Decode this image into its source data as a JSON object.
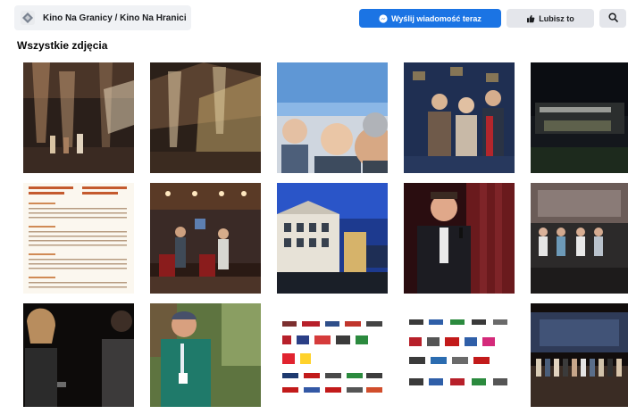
{
  "page": {
    "name": "Kino Na Granicy / Kino Na Hranici"
  },
  "actions": {
    "message_label": "Wyślij wiadomość teraz",
    "like_label": "Lubisz to"
  },
  "section": {
    "title": "Wszystkie zdjęcia"
  },
  "photos": [
    {
      "id": "awards-stage-1",
      "icon": "photo"
    },
    {
      "id": "awards-stage-2",
      "icon": "photo"
    },
    {
      "id": "selfie-three-women",
      "icon": "photo"
    },
    {
      "id": "group-press-wall",
      "icon": "photo"
    },
    {
      "id": "building-night",
      "icon": "photo"
    },
    {
      "id": "schedule-poster",
      "icon": "photo"
    },
    {
      "id": "stage-interview",
      "icon": "photo"
    },
    {
      "id": "town-square-screening",
      "icon": "photo"
    },
    {
      "id": "speaker-microphone",
      "icon": "photo"
    },
    {
      "id": "panel-on-stage",
      "icon": "photo"
    },
    {
      "id": "woman-microphone",
      "icon": "photo"
    },
    {
      "id": "older-man-portrait",
      "icon": "photo"
    },
    {
      "id": "sponsors-logos-1",
      "icon": "photo"
    },
    {
      "id": "sponsors-logos-2",
      "icon": "photo"
    },
    {
      "id": "group-on-stage",
      "icon": "photo"
    }
  ],
  "colors": {
    "primary": "#1b74e4",
    "secondary_button": "#e4e6eb",
    "page_chip": "#f0f2f5"
  }
}
